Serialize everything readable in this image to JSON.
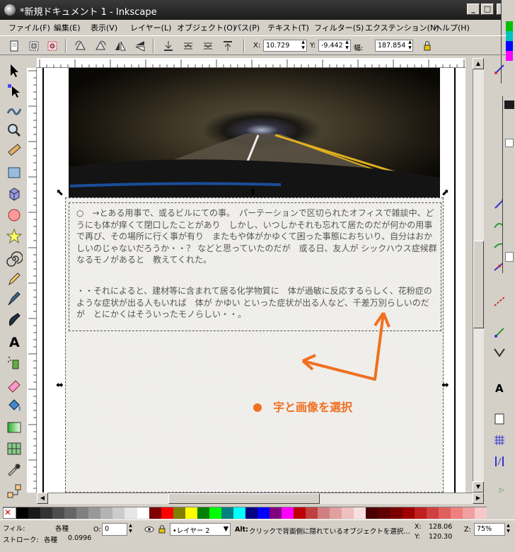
{
  "window": {
    "title": "*新規ドキュメント 1 - Inkscape"
  },
  "menu": [
    "ファイル(F)",
    "編集(E)",
    "表示(V)",
    "レイヤー(L)",
    "オブジェクト(O)",
    "パス(P)",
    "テキスト(T)",
    "フィルター(S)",
    "エクステンション(N)",
    "ヘルプ(H)"
  ],
  "coords": {
    "x_label": "X:",
    "x_value": "10.729",
    "y_label": "Y:",
    "y_value": "-9.442",
    "w_label": "幅:",
    "w_value": "187.854"
  },
  "document": {
    "para1": "○　→とある用事で、或るビルにての事。　パーテーションで区切られたオフィスで雑談中、どうにも体が痒くて閉口したことがあり　しかし、いつしかそれも忘れて居たのだが何かの用事で再び、その場所に行く事が有り　またもや体がかゆくて困った事態におちいり、自分はおかしいのじゃないだろうか・・？ などと思っていたのだが　或る日、友人が シックハウス症候群 なるモノがあると　教えてくれた。",
    "para2": "・・それによると、建材等に含まれて居る化学物質に　体が過敏に反応するらしく、花粉症のような症状が出る人もいれば　体が かゆい といった症状が出る人など、千差万別らしいのだが　とにかくはそういったモノらしい・・。",
    "annotation": "字と画像を選択"
  },
  "colors": {
    "accent": "#f07020"
  },
  "palette": [
    "none",
    "#000000",
    "#1a1a1a",
    "#333333",
    "#4d4d4d",
    "#666666",
    "#808080",
    "#999999",
    "#b3b3b3",
    "#cccccc",
    "#e6e6e6",
    "#ffffff",
    "#800000",
    "#ff0000",
    "#808000",
    "#ffff00",
    "#008000",
    "#00ff00",
    "#008080",
    "#00ffff",
    "#000080",
    "#0000ff",
    "#800080",
    "#ff00ff",
    "#c00000",
    "#c04040",
    "#d08080",
    "#e0a0a0",
    "#f0c0c0",
    "#f8e0e0",
    "#4a0000",
    "#600000",
    "#7a0000",
    "#a00000",
    "#c02020",
    "#d04040",
    "#e06060",
    "#f08080",
    "#f0a0a0",
    "#f8c8c8"
  ],
  "status": {
    "fill_label": "フィル:",
    "fill_value": "各種",
    "stroke_label": "ストローク:",
    "stroke_value": "各種",
    "stroke_width": "0.0996",
    "opacity_label": "O:",
    "opacity_value": "0",
    "layer_value": "•レイヤー 2",
    "message_bold": "Alt:",
    "message": "クリックで背面側に隠れているオブジェクトを選択…",
    "cursor_x_label": "X:",
    "cursor_x": "128.06",
    "cursor_y_label": "Y:",
    "cursor_y": "120.30",
    "zoom_label": "Z:",
    "zoom": "75%"
  }
}
